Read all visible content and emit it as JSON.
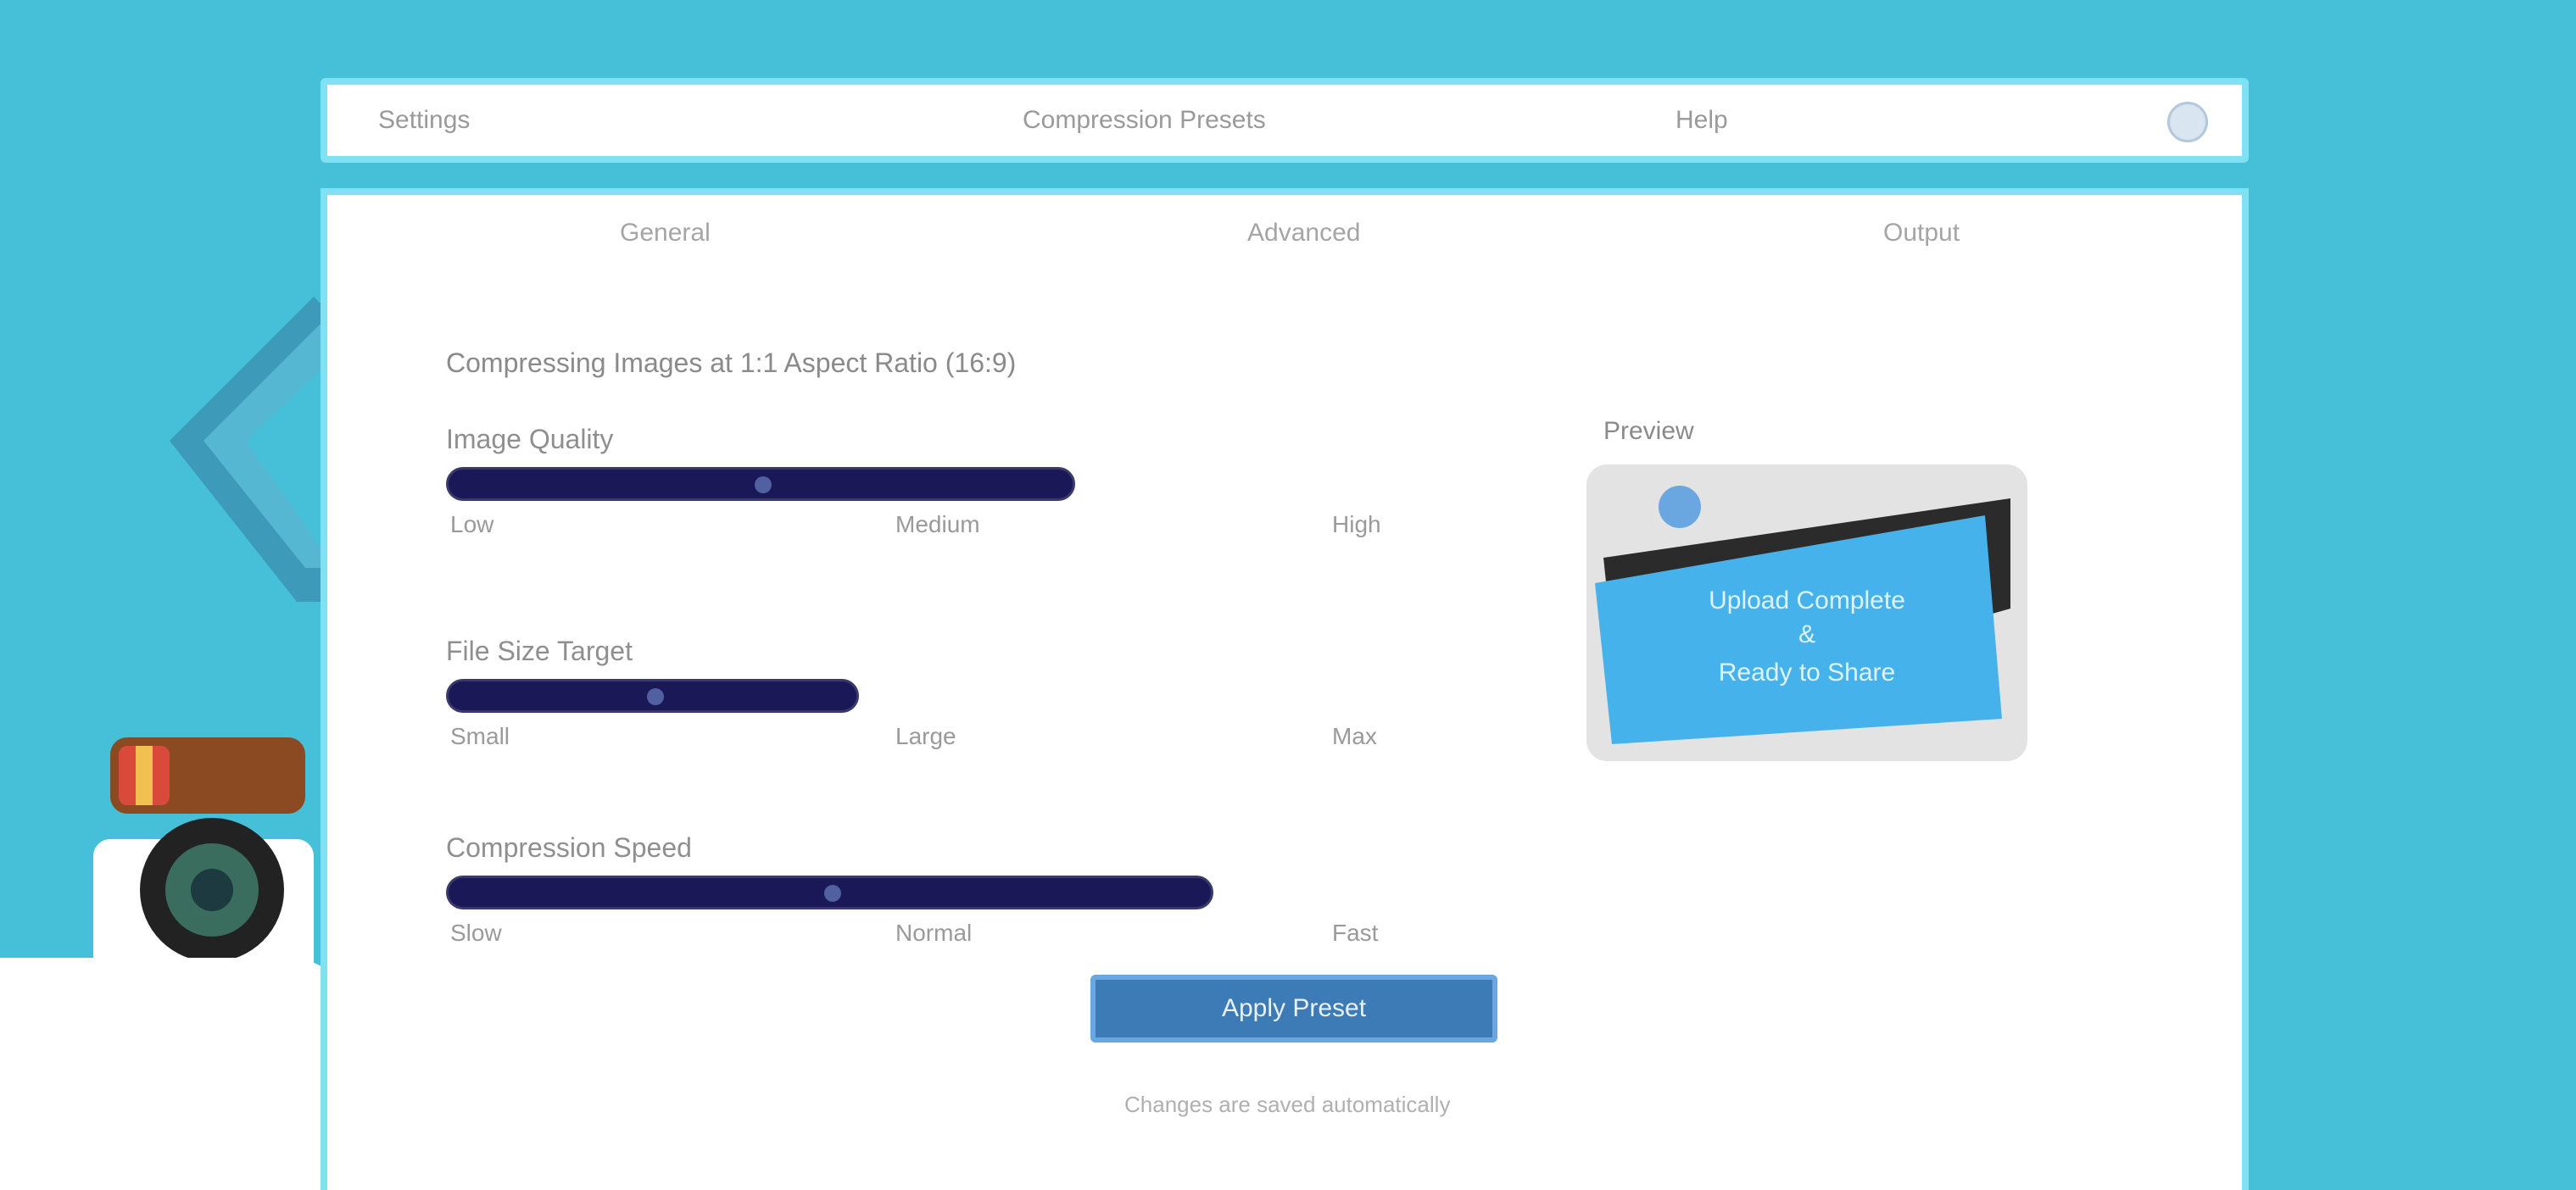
{
  "topbar": {
    "brand": "Settings",
    "center_text": "Compression Presets",
    "mid_text": "Help",
    "user_icon": "user-icon"
  },
  "tabs": [
    {
      "label": "General"
    },
    {
      "label": "Advanced"
    },
    {
      "label": "Output"
    }
  ],
  "main": {
    "heading": "Compressing Images at 1:1 Aspect Ratio (16:9)",
    "metrics": [
      {
        "label": "Image Quality",
        "fill_fraction": 0.32,
        "ticks": [
          "Low",
          "Medium",
          "High"
        ]
      },
      {
        "label": "File Size Target",
        "fill_fraction": 0.21,
        "ticks": [
          "Small",
          "Large",
          "Max"
        ]
      },
      {
        "label": "Compression Speed",
        "fill_fraction": 0.39,
        "ticks": [
          "Slow",
          "Normal",
          "Fast"
        ]
      }
    ],
    "sample_label": "Preview",
    "sample_card_text": [
      "Upload Complete",
      "&",
      "Ready to Share"
    ],
    "primary_button": "Apply Preset",
    "footnote": "Changes are saved automatically"
  },
  "colors": {
    "background": "#45c0d8",
    "bar_fill": "#1a1856",
    "button": "#3c7bb6",
    "accent_border": "#7fe1f2"
  }
}
